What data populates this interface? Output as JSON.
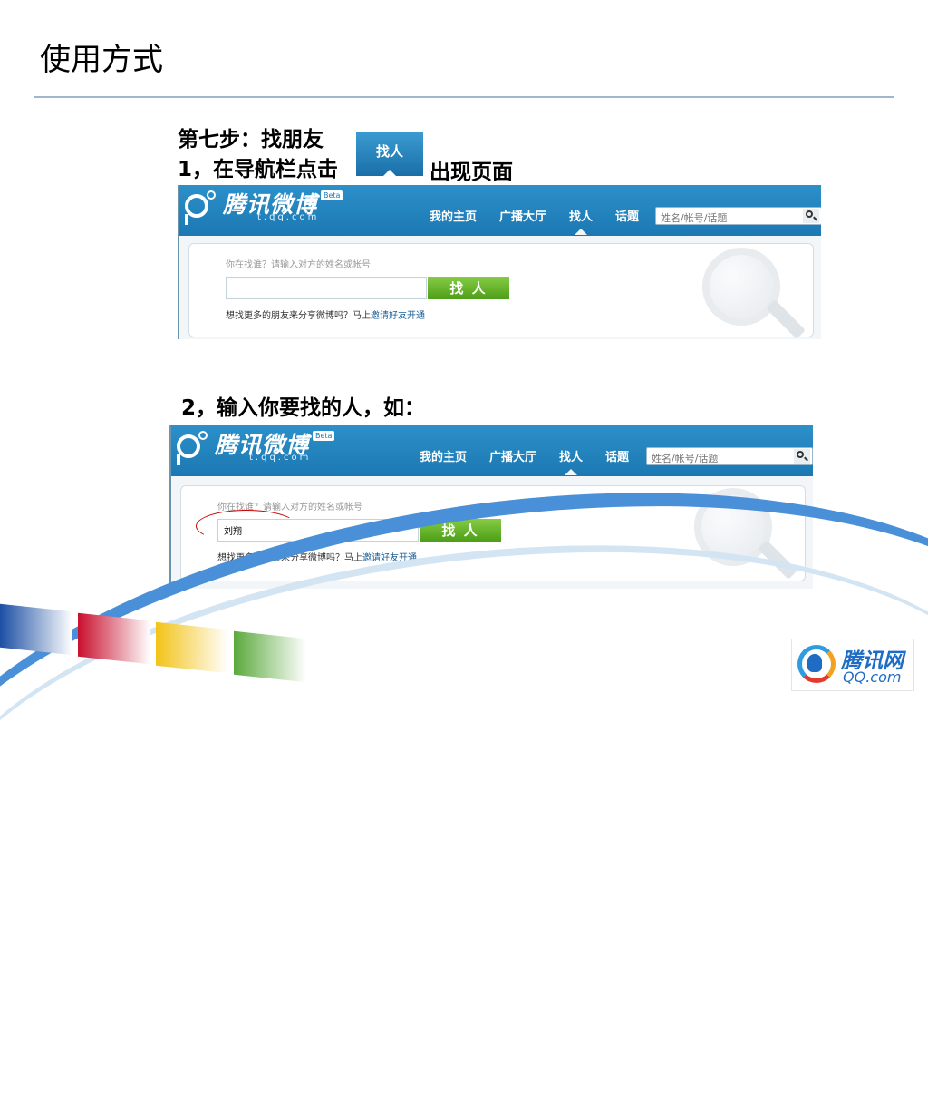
{
  "slide": {
    "title": "使用方式",
    "step_heading": "第七步：找朋友",
    "step1_prefix": "1，在导航栏点击",
    "step1_button_sample": "找人",
    "step1_suffix": "出现页面",
    "step2_text": "2，输入你要找的人，如："
  },
  "weibo_app": {
    "brand_name": "腾讯微博",
    "beta_badge": "Beta",
    "domain": "t.qq.com",
    "nav": {
      "home": "我的主页",
      "square": "广播大厅",
      "find_people": "找人",
      "topics": "话题"
    },
    "search_placeholder": "姓名/帐号/话题",
    "find_prompt": "你在找谁？请输入对方的姓名或帐号",
    "find_button": "找 人",
    "hint_text": "想找更多的朋友来分享微博吗？马上",
    "hint_link": "邀请好友开通"
  },
  "screenshot1": {
    "input_value": ""
  },
  "screenshot2": {
    "input_value": "刘翔"
  },
  "footer_logo": {
    "brand": "腾讯网",
    "domain": "QQ.com"
  },
  "colors": {
    "nav_bar": "#1b78b3",
    "find_button_green": "#4d9e18",
    "accent_blue": "#4a90d8",
    "stripe_blue": "#1c4fa3",
    "stripe_red": "#c8102e",
    "stripe_yellow": "#f2c318",
    "stripe_green": "#5aa93c"
  }
}
